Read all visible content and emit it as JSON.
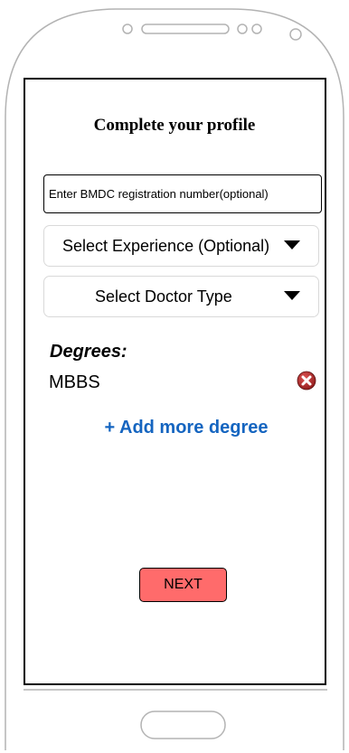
{
  "profile": {
    "title": "Complete your profile",
    "bmdc_placeholder": "Enter BMDC registration number(optional)",
    "experience_select": "Select Experience (Optional)",
    "doctor_type_select": "Select Doctor Type"
  },
  "degrees": {
    "heading": "Degrees:",
    "items": [
      "MBBS"
    ],
    "add_link": "+ Add more degree"
  },
  "actions": {
    "next_label": "NEXT"
  },
  "icons": {
    "remove": "remove-circle-icon",
    "dropdown": "caret-down-icon"
  },
  "colors": {
    "next_button": "#ff6b6b",
    "link": "#1565c0",
    "remove_icon": "#c62828"
  }
}
